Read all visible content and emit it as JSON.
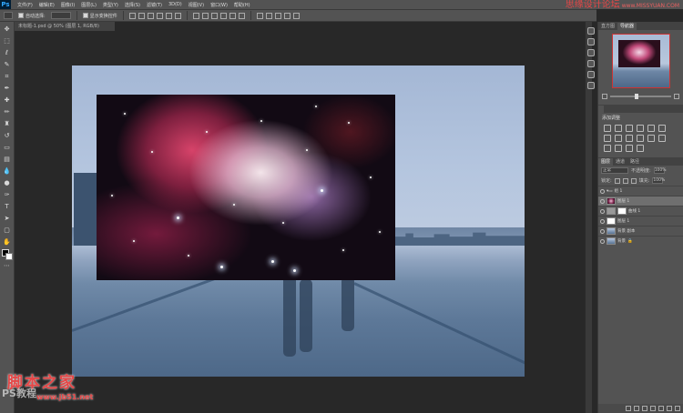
{
  "menubar": {
    "logo": "Ps",
    "items": [
      "文件(F)",
      "编辑(E)",
      "图像(I)",
      "图层(L)",
      "类型(Y)",
      "选择(S)",
      "滤镜(T)",
      "3D(D)",
      "视图(V)",
      "窗口(W)",
      "帮助(H)"
    ]
  },
  "watermark_top": {
    "text": "思缘设计论坛",
    "url": "www.MISSYUAN.COM"
  },
  "options": {
    "auto_select_label": "自动选择:",
    "auto_select_value": "图层",
    "transform_label": "显示变换控件"
  },
  "document": {
    "tab_title": "未标题-1.psd @ 50% (图层 1, RGB/8)"
  },
  "panels": {
    "nav_tabs": [
      "直方图",
      "导航器"
    ],
    "adjustments_title": "添加调整",
    "layers_tabs": [
      "图层",
      "通道",
      "路径"
    ],
    "blend_mode": "正常",
    "opacity_label": "不透明度:",
    "opacity_value": "100%",
    "lock_label": "锁定:",
    "fill_label": "填充:",
    "fill_value": "100%",
    "layers": [
      {
        "name": "组 1",
        "type": "group",
        "selected": false
      },
      {
        "name": "图层 1",
        "type": "space",
        "selected": true
      },
      {
        "name": "曲线 1",
        "type": "adj",
        "selected": false
      },
      {
        "name": "图层 1",
        "type": "white",
        "selected": false
      },
      {
        "name": "背景 副本",
        "type": "sky",
        "selected": false
      },
      {
        "name": "背景",
        "type": "sky",
        "selected": false
      }
    ]
  },
  "watermark_bottom": {
    "site": "脚本之家",
    "url": "www.jb51.net",
    "ps_text": "PS教程"
  }
}
